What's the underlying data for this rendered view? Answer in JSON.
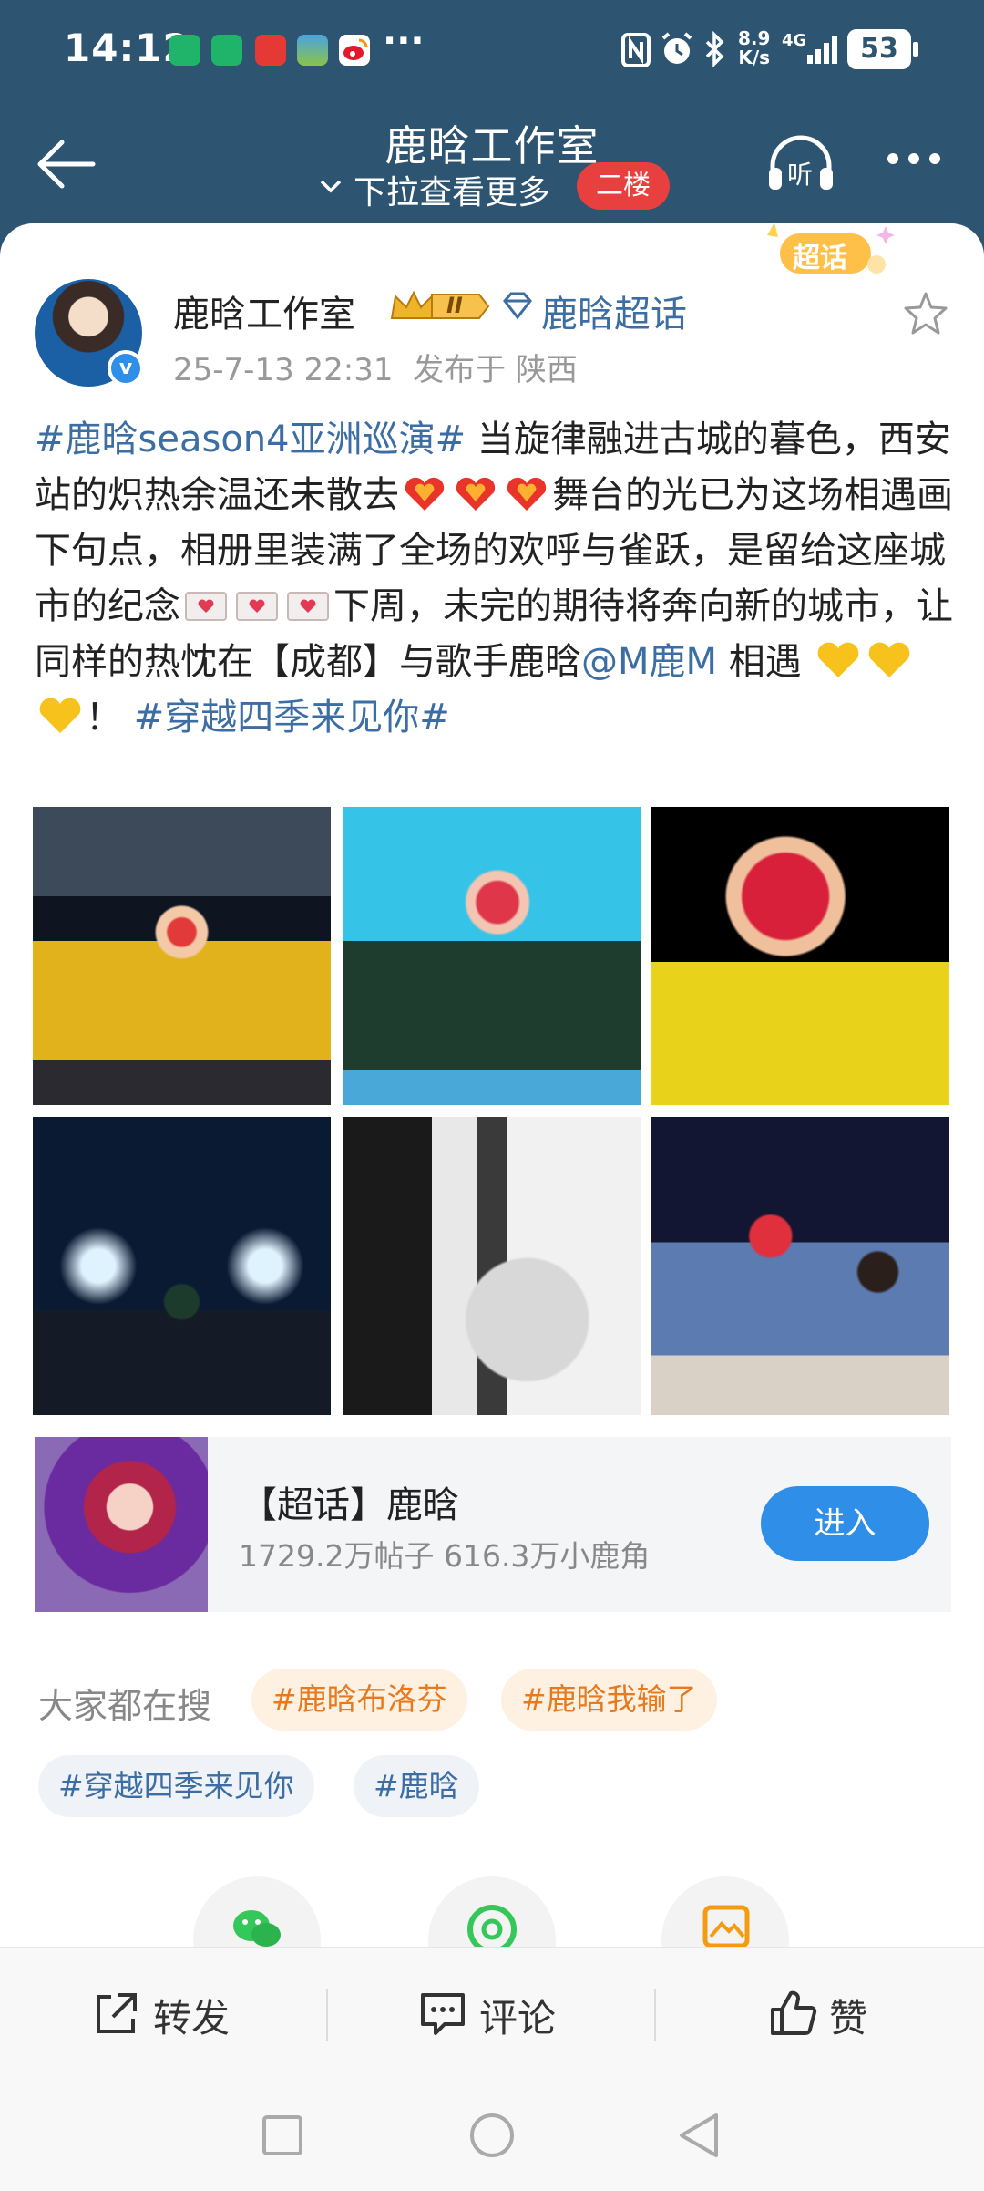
{
  "status_bar": {
    "time": "14:12",
    "speed_top": "8.9",
    "speed_bottom": "K/s",
    "network": "4G",
    "battery": "53",
    "more": "···"
  },
  "nav": {
    "title": "鹿晗工作室",
    "subtitle": "下拉查看更多",
    "floor_badge": "二楼",
    "listen_label": "听"
  },
  "super_topic_tag": "超话",
  "post": {
    "author": "鹿晗工作室",
    "level_badge": "II",
    "topic_link": "鹿晗超话",
    "time": "25-7-13 22:31",
    "location": "发布于 陕西",
    "text": {
      "tag1": "#鹿晗season4亚洲巡演#",
      "p1": " 当旋律融进古城的暮色，西安站的炽热余温还未散去",
      "p2": "舞台的光已为这场相遇画下句点，相册里装满了全场的欢呼与雀跃，是留给这座城市的纪念",
      "p3": "下周，未完的期待将奔向新的城市，让同样的热忱在【成都】与歌手鹿晗",
      "mention": "@M鹿M",
      "p4": " 相遇 ",
      "p5": "！ ",
      "tag2": "#穿越四季来见你#"
    }
  },
  "super_topic_card": {
    "title": "【超话】鹿晗",
    "stats": "1729.2万帖子 616.3万小鹿角",
    "button": "进入"
  },
  "hot_search": {
    "label": "大家都在搜",
    "chips": [
      "#鹿晗布洛芬",
      "#鹿晗我输了",
      "#穿越四季来见你",
      "#鹿晗"
    ]
  },
  "actions": {
    "repost": "转发",
    "comment": "评论",
    "like": "赞"
  },
  "colors": {
    "header_bg": "#2d5470",
    "link_blue": "#3c6ea3",
    "accent_blue": "#2f8ee8",
    "badge_red": "#e8403f",
    "chip_orange": "#e77a1e"
  }
}
